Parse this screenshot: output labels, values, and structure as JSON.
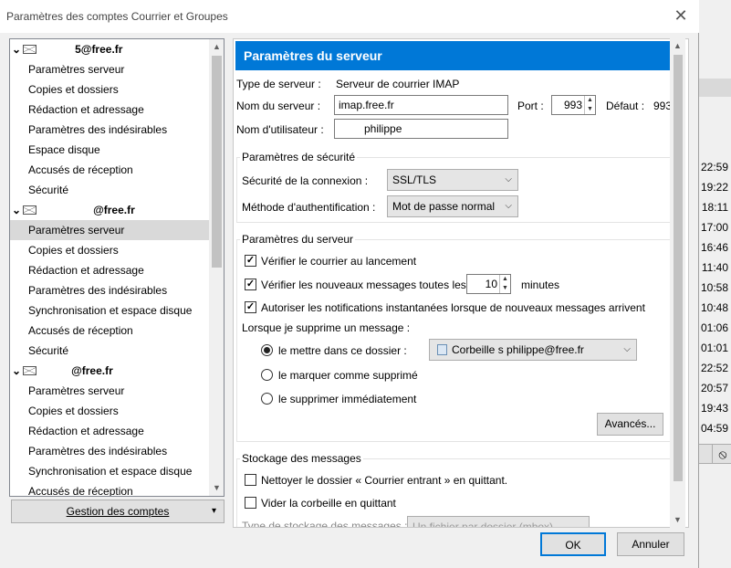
{
  "window": {
    "title": "Paramètres des comptes Courrier et Groupes",
    "close_glyph": "✕"
  },
  "tree": {
    "accounts": [
      {
        "name": "5@free.fr",
        "items": [
          "Paramètres serveur",
          "Copies et dossiers",
          "Rédaction et adressage",
          "Paramètres des indésirables",
          "Espace disque",
          "Accusés de réception",
          "Sécurité"
        ]
      },
      {
        "name": "@free.fr",
        "items": [
          "Paramètres serveur",
          "Copies et dossiers",
          "Rédaction et adressage",
          "Paramètres des indésirables",
          "Synchronisation et espace disque",
          "Accusés de réception",
          "Sécurité"
        ]
      },
      {
        "name": "@free.fr",
        "items": [
          "Paramètres serveur",
          "Copies et dossiers",
          "Rédaction et adressage",
          "Paramètres des indésirables",
          "Synchronisation et espace disque",
          "Accusés de réception"
        ]
      }
    ]
  },
  "account_actions": {
    "label": "Gestion des comptes",
    "arrow": "▾"
  },
  "panel": {
    "header": "Paramètres du serveur",
    "server_type_label": "Type de serveur :",
    "server_type_value": "Serveur de courrier IMAP",
    "server_name_label": "Nom du serveur :",
    "server_name_value": "imap.free.fr",
    "port_label": "Port :",
    "port_value": "993",
    "default_label": "Défaut :",
    "default_value": "993",
    "username_label": "Nom d'utilisateur :",
    "username_value": "philippe",
    "security": {
      "title": "Paramètres de sécurité",
      "connection_label": "Sécurité de la connexion :",
      "connection_value": "SSL/TLS",
      "auth_label": "Méthode d'authentification :",
      "auth_value": "Mot de passe normal"
    },
    "server_settings": {
      "title": "Paramètres du serveur",
      "check_on_startup": "Vérifier le courrier au lancement",
      "check_every": "Vérifier les nouveaux messages toutes les",
      "check_every_value": "10",
      "minutes": "minutes",
      "push_notifications": "Autoriser les notifications instantanées lorsque de nouveaux messages arrivent",
      "on_delete_label": "Lorsque je supprime un message :",
      "move_to_folder": "le mettre dans ce dossier :",
      "folder_value": "Corbeille s    philippe@free.fr",
      "mark_deleted": "le marquer comme supprimé",
      "delete_immediately": "le supprimer immédiatement",
      "advanced_button": "Avancés..."
    },
    "storage": {
      "title": "Stockage des messages",
      "clean_inbox": "Nettoyer le dossier « Courrier entrant » en quittant.",
      "empty_trash": "Vider la corbeille en quittant",
      "type_label": "Type de stockage des messages :",
      "type_value": "Un fichier par dossier (mbox)"
    }
  },
  "buttons": {
    "ok": "OK",
    "cancel": "Annuler"
  },
  "background_times": [
    "22:59",
    "19:22",
    "18:11",
    "17:00",
    "16:46",
    "11:40",
    "10:58",
    "10:48",
    "01:06",
    "01:01",
    "22:52",
    "20:57",
    "19:43",
    "04:59"
  ]
}
